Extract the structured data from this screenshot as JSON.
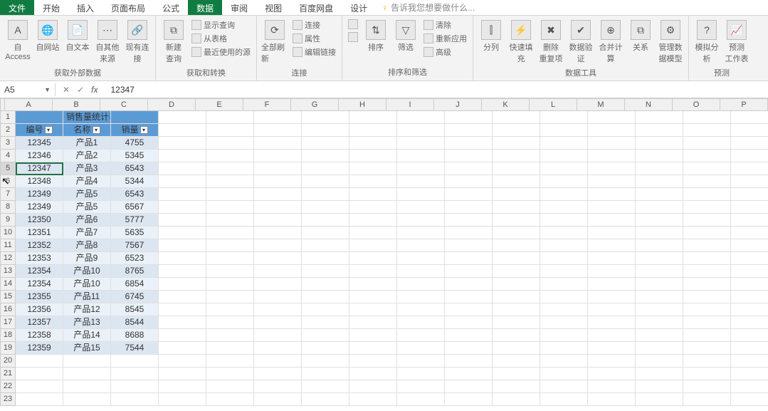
{
  "tabs": [
    "文件",
    "开始",
    "插入",
    "页面布局",
    "公式",
    "数据",
    "审阅",
    "视图",
    "百度网盘",
    "设计"
  ],
  "active_tab_index": 5,
  "tellme": {
    "prompt": "告诉我您想要做什么..."
  },
  "ribbon": {
    "g_ext": {
      "label": "获取外部数据",
      "btns": [
        "自 Access",
        "自网站",
        "自文本",
        "自其他来源",
        "现有连接"
      ]
    },
    "g_query": {
      "label": "获取和转换",
      "new_query": "新建\n查询",
      "rows": [
        "显示查询",
        "从表格",
        "最近使用的源"
      ]
    },
    "g_conn": {
      "label": "连接",
      "refresh": "全部刷新",
      "rows": [
        "连接",
        "属性",
        "编辑链接"
      ]
    },
    "g_sort": {
      "label": "排序和筛选",
      "az": "A↓Z",
      "za": "Z↓A",
      "sort": "排序",
      "filter": "筛选",
      "rows": [
        "清除",
        "重新应用",
        "高级"
      ]
    },
    "g_tools": {
      "label": "数据工具",
      "btns": [
        "分列",
        "快速填充",
        "删除\n重复项",
        "数据验\n证",
        "合并计算",
        "关系",
        "管理数\n据模型"
      ]
    },
    "g_fc": {
      "label": "预测",
      "btns": [
        "模拟分析",
        "预测\n工作表"
      ]
    }
  },
  "namebox": {
    "ref": "A5"
  },
  "formula": {
    "value": "12347"
  },
  "columns": [
    "A",
    "B",
    "C",
    "D",
    "E",
    "F",
    "G",
    "H",
    "I",
    "J",
    "K",
    "L",
    "M",
    "N",
    "O",
    "P"
  ],
  "col_widths": {
    "A": 67,
    "B": 67,
    "C": 67,
    "other": 67
  },
  "row_start": 1,
  "row_end": 23,
  "selected_row": 5,
  "selected_cell": "A5",
  "table": {
    "title": "销售量统计表",
    "headers": [
      "编号",
      "名称",
      "销量"
    ],
    "rows": [
      [
        "12345",
        "产品1",
        "4755"
      ],
      [
        "12346",
        "产品2",
        "5345"
      ],
      [
        "12347",
        "产品3",
        "6543"
      ],
      [
        "12348",
        "产品4",
        "5344"
      ],
      [
        "12349",
        "产品5",
        "6543"
      ],
      [
        "12349",
        "产品5",
        "6567"
      ],
      [
        "12350",
        "产品6",
        "5777"
      ],
      [
        "12351",
        "产品7",
        "5635"
      ],
      [
        "12352",
        "产品8",
        "7567"
      ],
      [
        "12353",
        "产品9",
        "6523"
      ],
      [
        "12354",
        "产品10",
        "8765"
      ],
      [
        "12354",
        "产品10",
        "6854"
      ],
      [
        "12355",
        "产品11",
        "6745"
      ],
      [
        "12356",
        "产品12",
        "8545"
      ],
      [
        "12357",
        "产品13",
        "8544"
      ],
      [
        "12358",
        "产品14",
        "8688"
      ],
      [
        "12359",
        "产品15",
        "7544"
      ]
    ]
  }
}
